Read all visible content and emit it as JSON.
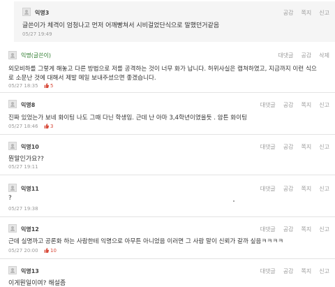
{
  "comments": [
    {
      "name": "익명3",
      "text": "글쓴이가 체격이 엄청나고 먼저 어깨빵쳐서 시비걸었단식으로 말했던거같음",
      "date": "05/27 19:49",
      "actions": [
        "공감",
        "쪽지",
        "신고"
      ]
    },
    {
      "name": "익명(글쓴이)",
      "text": "외모비하를 그렇게 해놓고 다른 방법으로 저를 공격하는 것이 너무 화가 납니다. 허위사실은 캡쳐하였고, 지금까지 이런 식으",
      "text2": "로 소문난 것에 대해서 제발 메일 보내주셨으면 좋겠습니다.",
      "date": "05/27 18:35",
      "likes": "5",
      "actions": [
        "대댓글",
        "공감",
        "삭제"
      ]
    },
    {
      "name": "익명8",
      "text": "진짜 있었는가 보네 화이팅 나도 그때 다닌 학생임. 근데 난 아마 3,4학년이였을듯 . 암튼 화이팅",
      "date": "05/27 18:46",
      "likes": "3",
      "actions": [
        "대댓글",
        "공감",
        "쪽지",
        "신고"
      ]
    },
    {
      "name": "익명10",
      "text": "뭔말인가요??",
      "date": "05/27 19:11",
      "actions": [
        "대댓글",
        "공감",
        "쪽지",
        "신고"
      ]
    },
    {
      "name": "익명11",
      "text": "?",
      "date": "05/27 19:38",
      "actions": [
        "대댓글",
        "공감",
        "쪽지",
        "신고"
      ]
    },
    {
      "name": "익명12",
      "text": "근데 실명까고 공론화 하는 사람한테 익명으로 아무튼 아니었음 이러면 그 사람 말이 신뢰가 갈까 싶음ㅋㅋㅋㅋ",
      "date": "05/27 20:00",
      "likes": "10",
      "actions": [
        "대댓글",
        "공감",
        "쪽지",
        "신고"
      ]
    },
    {
      "name": "익명13",
      "text": "이게뭔일이여? 해설좀",
      "date": "",
      "actions": [
        "대댓글",
        "공감",
        "쪽지",
        "신고"
      ]
    }
  ],
  "colors": {
    "like": "#d84a3a",
    "owner": "#2a7a2a",
    "muted": "#9a9a9a"
  }
}
